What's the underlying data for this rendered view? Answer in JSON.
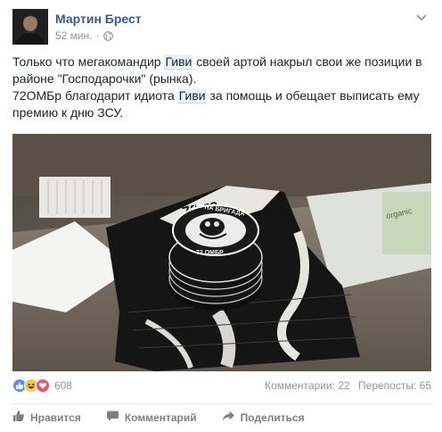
{
  "post": {
    "author": "Мартин Брест",
    "time": "52 мин.",
    "separator": "·",
    "text": {
      "l1_a": "Только что мегакомандир ",
      "l1_link": "Гиви",
      "l1_b": " своей артой накрыл свои же позиции в",
      "l2": "районе \"Господарочки\" (рынка).",
      "l3_a": "72ОМБр благодарит идиота ",
      "l3_link": "Гиви",
      "l3_b": " за помощь и обещает выписать ему",
      "l4": "премию к дню ЗСУ."
    },
    "photo_text": {
      "flag_label": "72-га",
      "patch_top": "ЧОРНА БРИГАДА",
      "patch_bottom": "72 ОМБР"
    }
  },
  "stats": {
    "reactions_count": "608",
    "comments": "Комментарии: 22",
    "shares": "Перепосты: 65"
  },
  "actions": {
    "like": "Нравится",
    "comment": "Комментарий",
    "share": "Поделиться"
  },
  "colors": {
    "link": "#365899",
    "meta": "#90949c",
    "like": "#5890ff",
    "love": "#f25268",
    "haha": "#f7c945"
  },
  "icons": [
    "globe-icon",
    "chevron-down-icon",
    "like-reaction-icon",
    "haha-reaction-icon",
    "love-reaction-icon",
    "thumbs-up-icon",
    "comment-icon",
    "share-icon"
  ]
}
